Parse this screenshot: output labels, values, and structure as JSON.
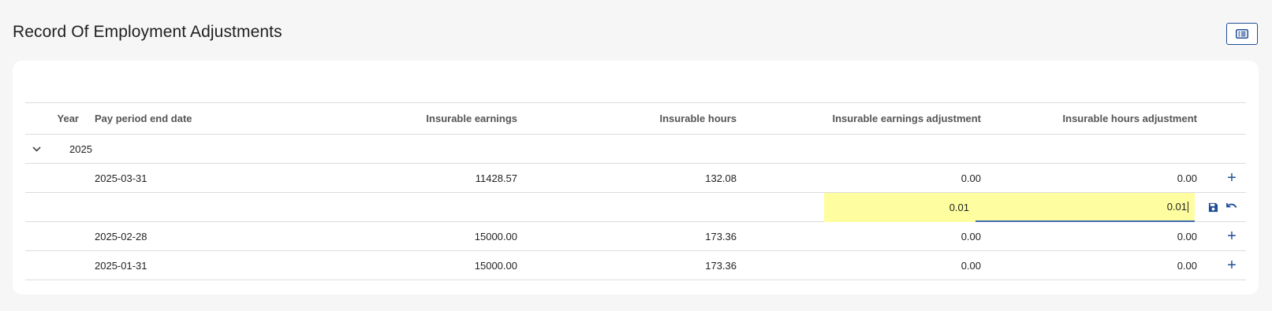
{
  "page": {
    "title": "Record Of Employment Adjustments"
  },
  "table": {
    "columns": {
      "year": "Year",
      "pay_period_end_date": "Pay period end date",
      "insurable_earnings": "Insurable earnings",
      "insurable_hours": "Insurable hours",
      "insurable_earnings_adjustment": "Insurable earnings adjustment",
      "insurable_hours_adjustment": "Insurable hours adjustment"
    },
    "group": {
      "year": "2025",
      "expanded": true
    },
    "rows": [
      {
        "date": "2025-03-31",
        "earnings": "11428.57",
        "hours": "132.08",
        "earnings_adj": "0.00",
        "hours_adj": "0.00"
      },
      {
        "date": "2025-02-28",
        "earnings": "15000.00",
        "hours": "173.36",
        "earnings_adj": "0.00",
        "hours_adj": "0.00"
      },
      {
        "date": "2025-01-31",
        "earnings": "15000.00",
        "hours": "173.36",
        "earnings_adj": "0.00",
        "hours_adj": "0.00"
      }
    ],
    "edit_row": {
      "earnings_adj": "0.01",
      "hours_adj": "0.01"
    }
  },
  "icons": {
    "view_toggle": "list-view-icon",
    "chevron": "chevron-down-icon",
    "add": "plus-icon",
    "save": "save-icon",
    "undo": "undo-icon"
  },
  "colors": {
    "accent": "#1f4e96",
    "edit_highlight": "#fefea0",
    "edit_underline": "#3f6ab0"
  }
}
